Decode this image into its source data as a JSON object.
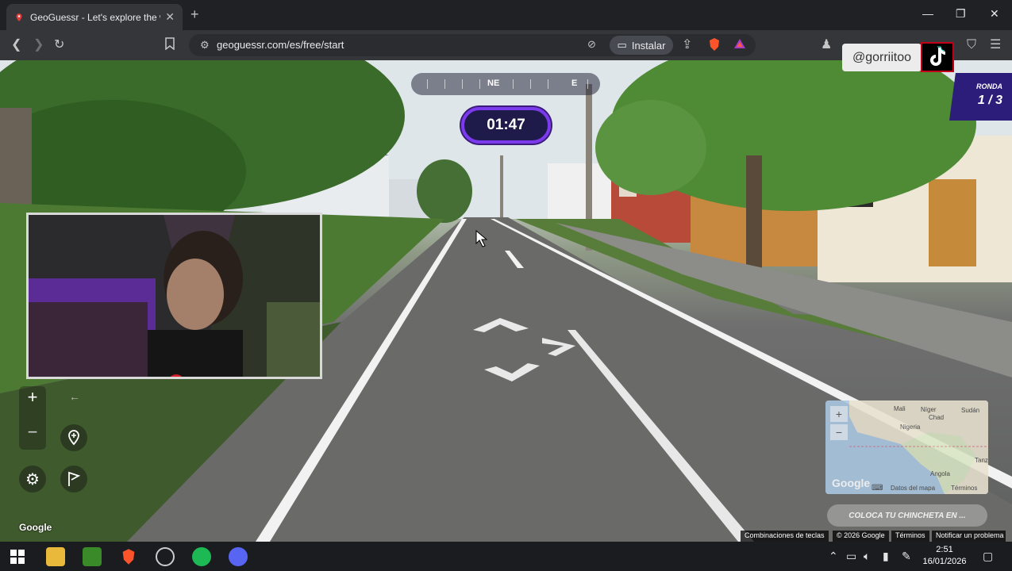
{
  "browser": {
    "tab_title": "GeoGuessr - Let's explore the w",
    "new_tab": "+",
    "url": "geoguessr.com/es/free/start",
    "install_label": "Instalar"
  },
  "game": {
    "compass": {
      "primary": "NE",
      "secondary": "E"
    },
    "timer": "01:47",
    "round_label": "RONDA",
    "round_value": "1 / 3",
    "guess_button": "COLOCA TU CHINCHETA EN ..."
  },
  "overlay": {
    "tiktok_handle": "@gorriitoo"
  },
  "minimap": {
    "labels": [
      "Mali",
      "Níger",
      "Chad",
      "Sudán",
      "Nigeria",
      "Tanz",
      "Angola"
    ],
    "logo": "Google",
    "map_data": "Datos del mapa",
    "terms": "Términos"
  },
  "streetview": {
    "google_logo": "Google",
    "shortcuts": "Combinaciones de teclas",
    "copyright": "© 2026 Google",
    "terms": "Términos",
    "report": "Notificar un problema"
  },
  "taskbar": {
    "time": "2:51",
    "date": "16/01/2026"
  },
  "colors": {
    "timer_border": "#7c3aed",
    "round_bg": "#2d1d7a",
    "brave_orange": "#fb542b",
    "spotify_green": "#1db954"
  }
}
